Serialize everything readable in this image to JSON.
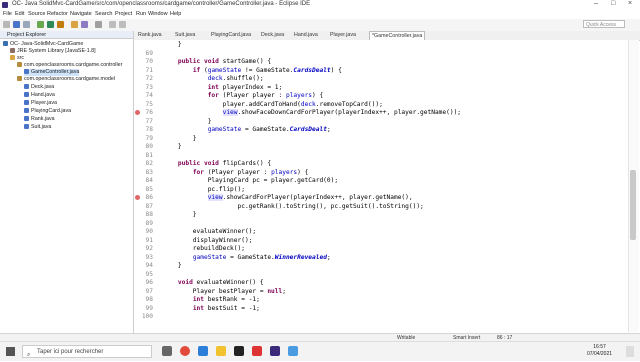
{
  "window": {
    "title": "OC- Java SolidMvc-CardGame/src/com/openclassrooms/cardgame/controller/GameController.java - Eclipse IDE"
  },
  "menu": [
    "File",
    "Edit",
    "Source",
    "Refactor",
    "Navigate",
    "Search",
    "Project",
    "Run",
    "Window",
    "Help"
  ],
  "quick_access": "Quick Access",
  "project_explorer": {
    "header": "Project Explorer",
    "tree": [
      {
        "label": "OC- Java-SolidMvc-CardGame"
      },
      {
        "label": "JRE System Library [JavaSE-1.8]"
      },
      {
        "label": "src"
      },
      {
        "label": "com.openclassrooms.cardgame.controller"
      },
      {
        "label": "GameController.java"
      },
      {
        "label": "com.openclassrooms.cardgame.model"
      },
      {
        "label": "Deck.java"
      },
      {
        "label": "Hand.java"
      },
      {
        "label": "Player.java"
      },
      {
        "label": "PlayingCard.java"
      },
      {
        "label": "Rank.java"
      },
      {
        "label": "Suit.java"
      }
    ]
  },
  "tabs": [
    "Rank.java",
    "Suit.java",
    "PlayingCard.java",
    "Deck.java",
    "Hand.java",
    "Player.java",
    "*GameController.java"
  ],
  "line_numbers": [
    "",
    "69",
    "70",
    "71",
    "72",
    "73",
    "74",
    "75",
    "76",
    "77",
    "78",
    "79",
    "80",
    "81",
    "82",
    "83",
    "84",
    "85",
    "86",
    "87",
    "88",
    "89",
    "90",
    "91",
    "92",
    "93",
    "94",
    "95",
    "96",
    "97",
    "98",
    "99",
    "100"
  ],
  "status": {
    "writable": "Writable",
    "insert_mode": "Smart Insert",
    "position": "86 : 17"
  },
  "taskbar": {
    "search_placeholder": "Taper ici pour rechercher",
    "time": "16:57",
    "date": "07/04/2021"
  }
}
